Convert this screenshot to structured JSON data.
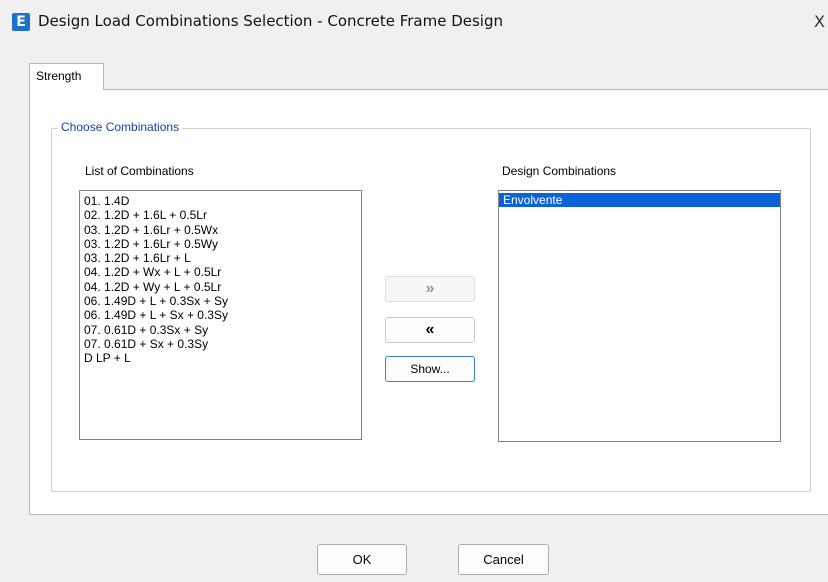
{
  "window": {
    "app_icon_letter": "E",
    "title": "Design Load Combinations Selection - Concrete Frame Design",
    "close_glyph": "X"
  },
  "tabs": [
    {
      "label": "Strength",
      "active": true
    }
  ],
  "group": {
    "label": "Choose Combinations"
  },
  "list_of_combinations": {
    "label": "List of Combinations",
    "items": [
      "01. 1.4D",
      "02. 1.2D + 1.6L + 0.5Lr",
      "03. 1.2D + 1.6Lr + 0.5Wx",
      "03. 1.2D + 1.6Lr + 0.5Wy",
      "03. 1.2D + 1.6Lr + L",
      "04. 1.2D + Wx + L + 0.5Lr",
      "04. 1.2D + Wy + L + 0.5Lr",
      "06. 1.49D + L + 0.3Sx + Sy",
      "06. 1.49D + L + Sx + 0.3Sy",
      "07. 0.61D + 0.3Sx + Sy",
      "07. 0.61D + Sx + 0.3Sy",
      "D LP + L"
    ]
  },
  "design_combinations": {
    "label": "Design Combinations",
    "items": [
      {
        "label": "Envolvente",
        "selected": true
      }
    ]
  },
  "transfer_buttons": {
    "add_label": "»",
    "remove_label": "«",
    "show_label": "Show..."
  },
  "footer": {
    "ok_label": "OK",
    "cancel_label": "Cancel"
  },
  "colors": {
    "selection": "#0a64d8",
    "group_label": "#1a3fb0",
    "app_icon": "#1a73c8"
  }
}
